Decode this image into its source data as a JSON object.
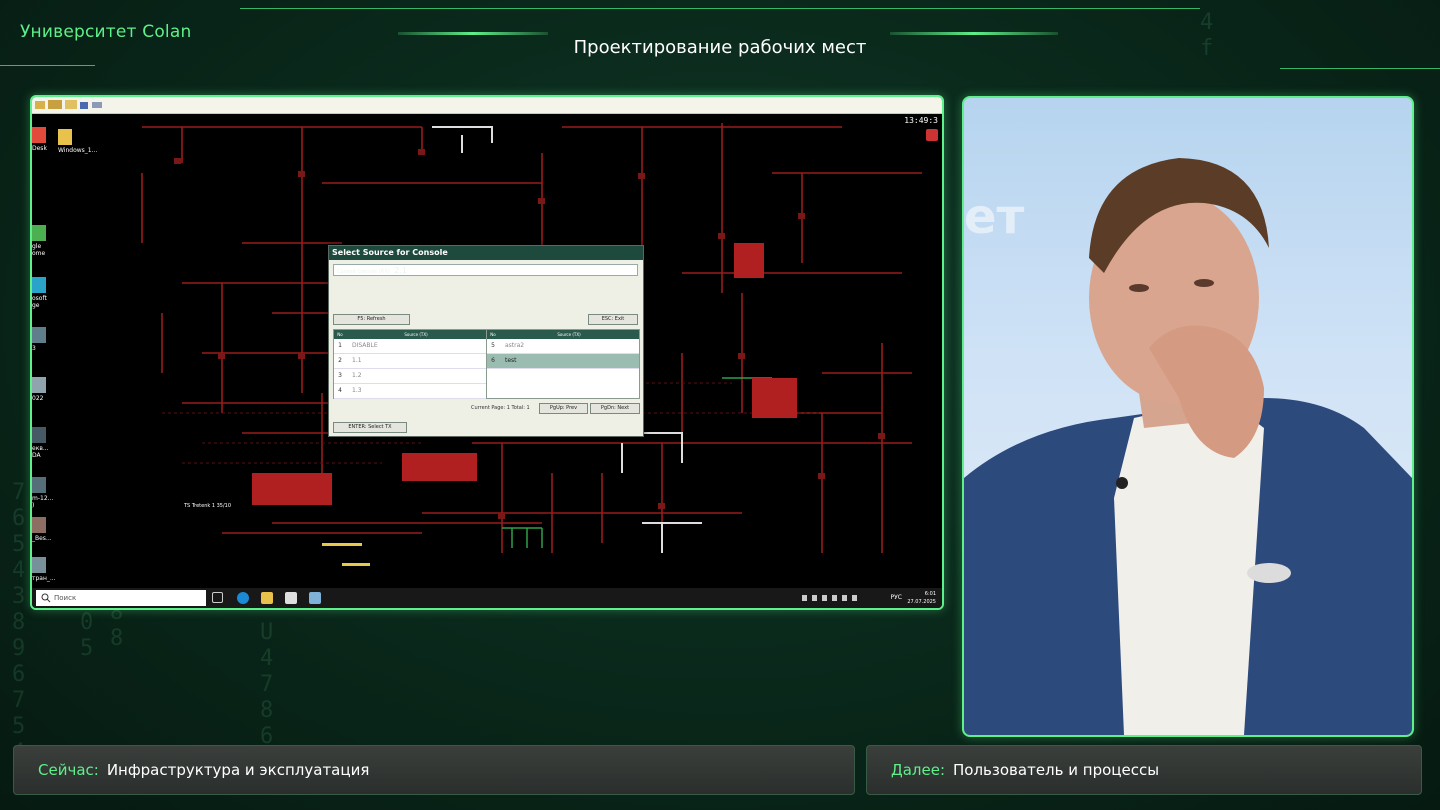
{
  "brand": "Университет Colan",
  "segment_title": "Проектирование рабочих мест",
  "screen": {
    "clock_top": "13:49:3",
    "desktop_icons": [
      {
        "label": "Desk",
        "color": "#e24b3b"
      },
      {
        "label": "Windows_1...",
        "color": "#e8c24a"
      },
      {
        "label": "gle\nome",
        "color": "#4caf50"
      },
      {
        "label": "osoft\nge",
        "color": "#2aa3c8"
      },
      {
        "label": "3",
        "color": "#607d8b"
      },
      {
        "label": "022",
        "color": "#90a4ae"
      },
      {
        "label": "екв...\nDA",
        "color": "#455a64"
      },
      {
        "label": "m-12...\n)",
        "color": "#546e7a"
      },
      {
        "label": "_Bes...",
        "color": "#8d6e63"
      },
      {
        "label": "тран_...",
        "color": "#78909c"
      }
    ],
    "schematic_label": "TS Tretenk 1 35/10",
    "dialog": {
      "title": "Select Source for Console",
      "current_label": "Current Console (RX):",
      "current_value": "2.1",
      "refresh_btn": "F5: Refresh",
      "exit_btn": "ESC: Exit",
      "table_left": {
        "col_no": "No",
        "col_name": "Source (TX)",
        "rows": [
          {
            "no": "1",
            "name": "DISABLE"
          },
          {
            "no": "2",
            "name": "1.1"
          },
          {
            "no": "3",
            "name": "1.2"
          },
          {
            "no": "4",
            "name": "1.3"
          }
        ]
      },
      "table_right": {
        "col_no": "No",
        "col_name": "Source (TX)",
        "rows": [
          {
            "no": "5",
            "name": "astra2"
          },
          {
            "no": "6",
            "name": "test",
            "selected": true
          }
        ]
      },
      "page_info": "Current Page: 1  Total: 1",
      "prev_btn": "PgUp: Prev",
      "next_btn": "PgDn: Next",
      "enter_btn": "ENTER: Select TX"
    },
    "taskbar": {
      "search_placeholder": "Поиск",
      "lang": "РУС",
      "time": "6:01",
      "date": "27.07.2025"
    }
  },
  "bottom": {
    "now_label": "Сейчас:",
    "now_value": "Инфраструктура и эксплуатация",
    "next_label": "Далее:",
    "next_value": "Пользователь и процессы"
  }
}
